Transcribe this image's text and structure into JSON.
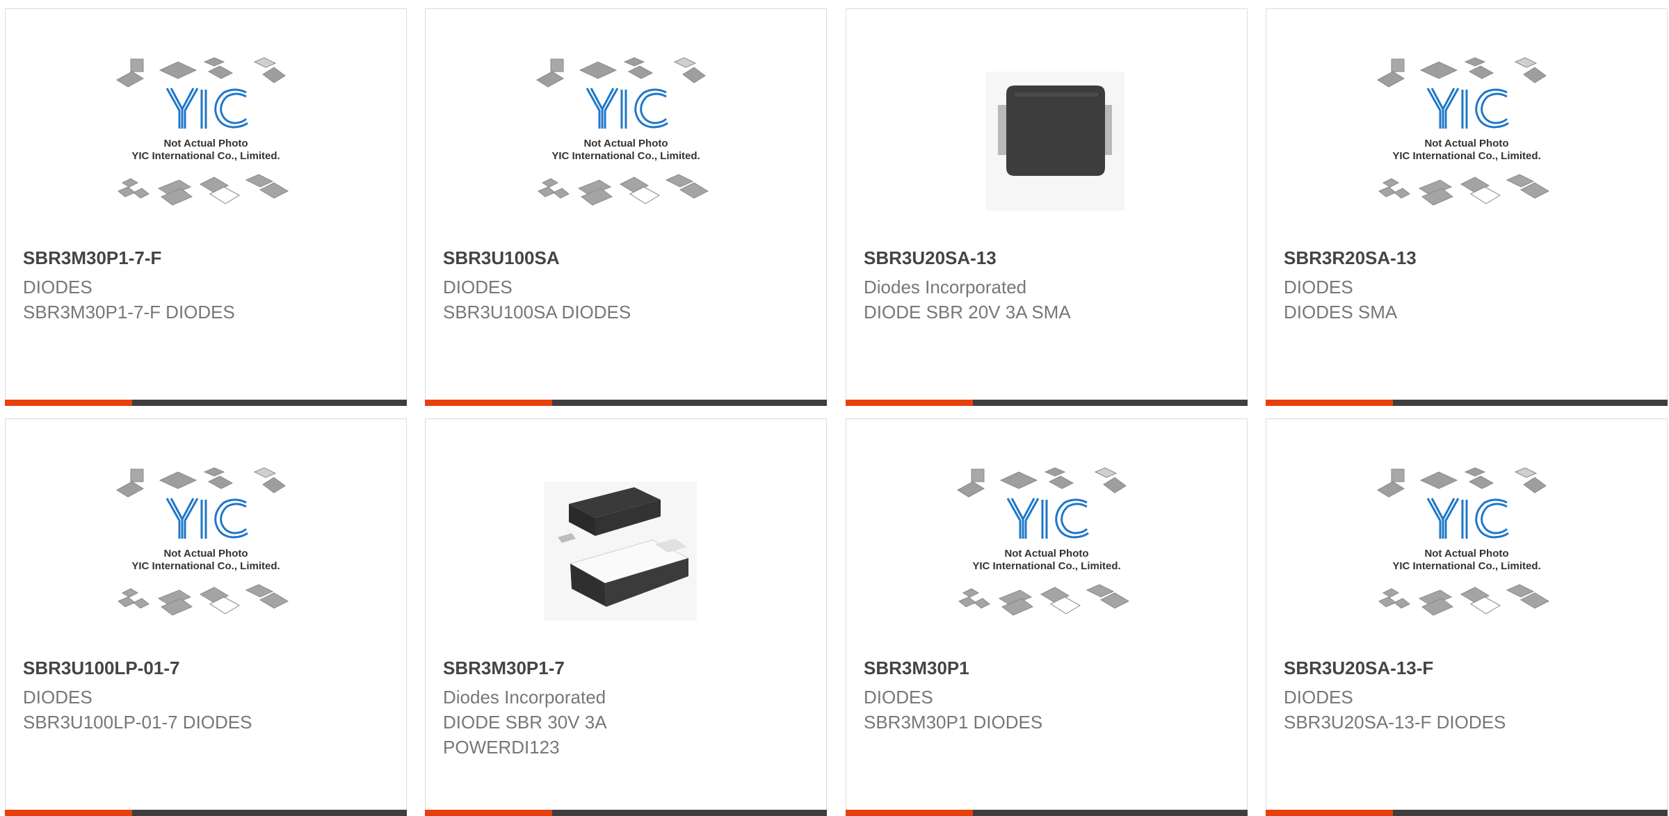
{
  "products": [
    {
      "part": "SBR3M30P1-7-F",
      "brand": "DIODES",
      "description": "SBR3M30P1-7-F DIODES",
      "image": "yic-placeholder-icon"
    },
    {
      "part": "SBR3U100SA",
      "brand": "DIODES",
      "description": "SBR3U100SA DIODES",
      "image": "yic-placeholder-icon"
    },
    {
      "part": "SBR3U20SA-13",
      "brand": "Diodes Incorporated",
      "description": "DIODE SBR 20V 3A SMA",
      "image": "sma-package-icon"
    },
    {
      "part": "SBR3R20SA-13",
      "brand": "DIODES",
      "description": "DIODES SMA",
      "image": "yic-placeholder-icon"
    },
    {
      "part": "SBR3U100LP-01-7",
      "brand": "DIODES",
      "description": "SBR3U100LP-01-7 DIODES",
      "image": "yic-placeholder-icon"
    },
    {
      "part": "SBR3M30P1-7",
      "brand": "Diodes Incorporated",
      "description": "DIODE SBR 30V 3A POWERDI123",
      "image": "powerdi123-package-icon"
    },
    {
      "part": "SBR3M30P1",
      "brand": "DIODES",
      "description": "SBR3M30P1 DIODES",
      "image": "yic-placeholder-icon"
    },
    {
      "part": "SBR3U20SA-13-F",
      "brand": "DIODES",
      "description": "SBR3U20SA-13-F DIODES",
      "image": "yic-placeholder-icon"
    }
  ],
  "placeholder": {
    "logo": "YIC",
    "line1": "Not Actual Photo",
    "line2": "YIC International Co., Limited."
  },
  "colors": {
    "accent": "#e8400c",
    "bar": "#3e3e3e",
    "logo_blue": "#1f77c8"
  }
}
